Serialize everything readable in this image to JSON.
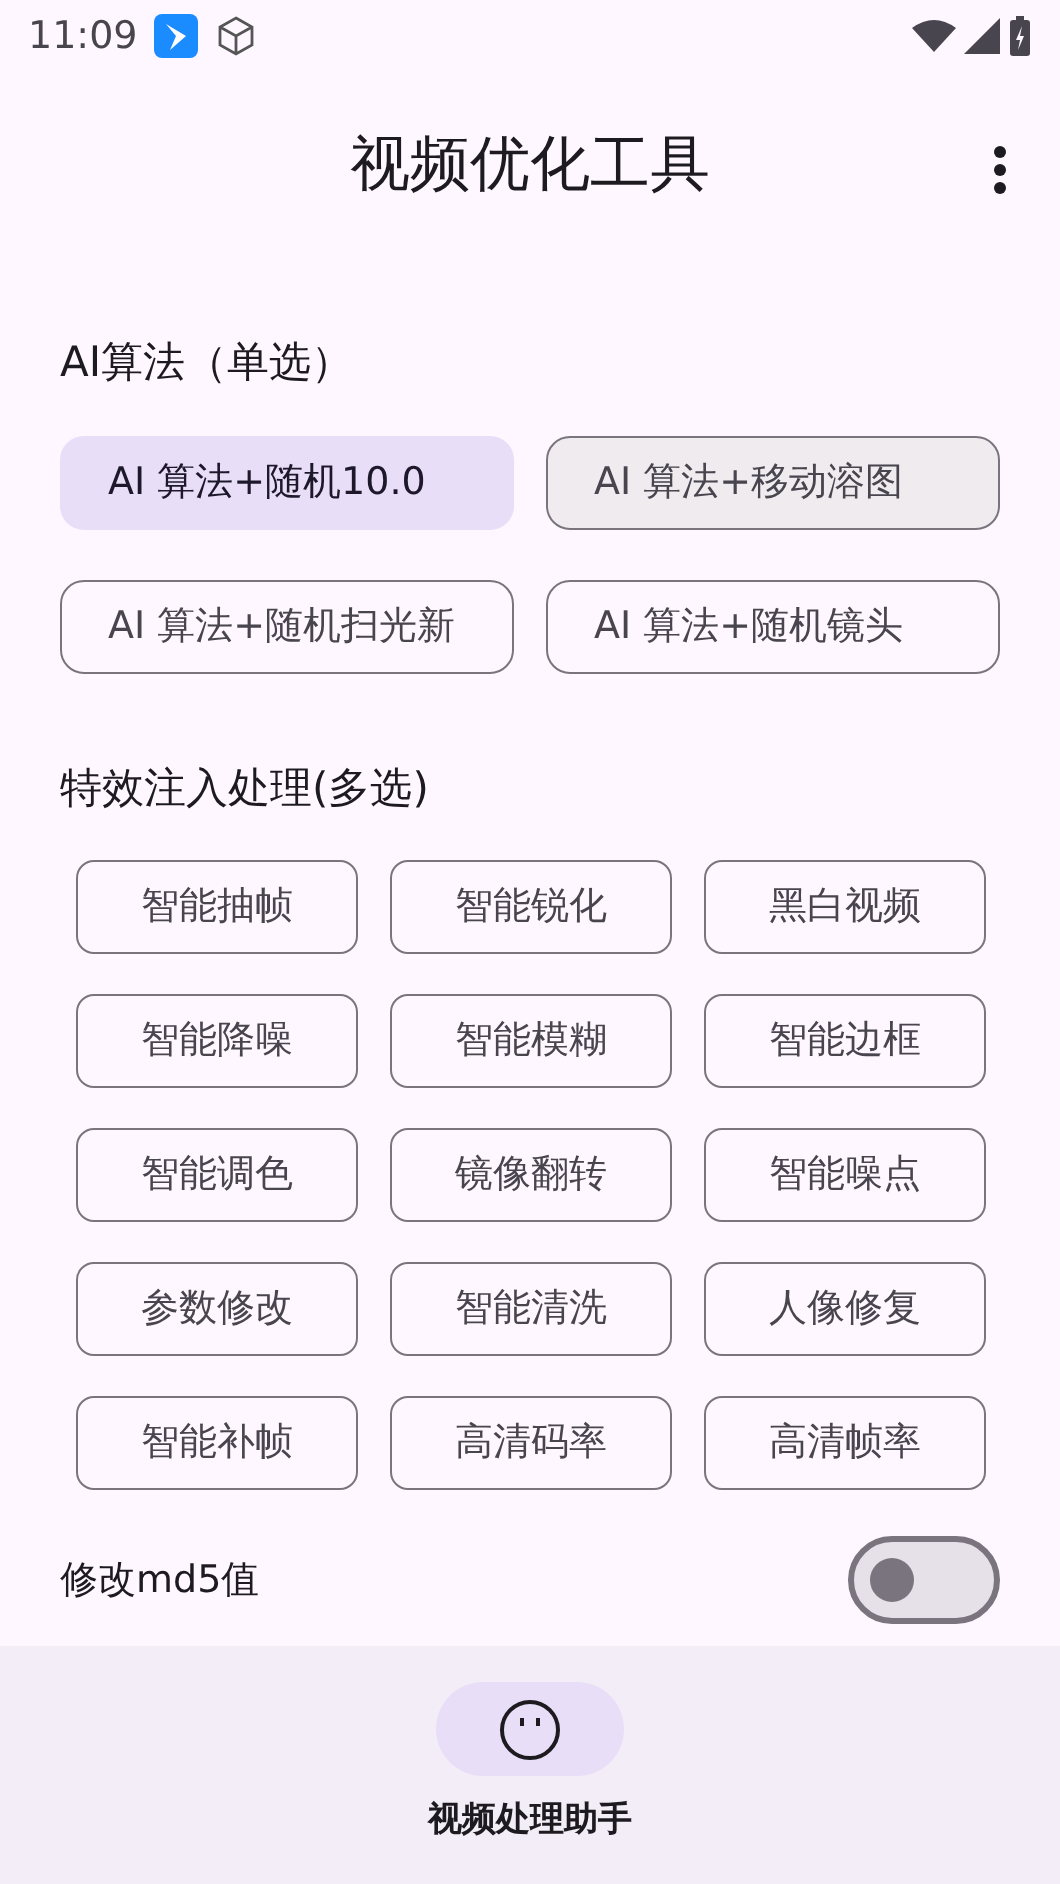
{
  "status_bar": {
    "time": "11:09"
  },
  "app_bar": {
    "title": "视频优化工具"
  },
  "algorithm": {
    "heading": "AI算法（单选）",
    "options": [
      {
        "label": "AI 算法+随机10.0",
        "selected": true,
        "pressed": false
      },
      {
        "label": "AI 算法+移动溶图",
        "selected": false,
        "pressed": true
      },
      {
        "label": "AI 算法+随机扫光新",
        "selected": false,
        "pressed": false
      },
      {
        "label": "AI 算法+随机镜头",
        "selected": false,
        "pressed": false
      }
    ]
  },
  "effects": {
    "heading": "特效注入处理(多选)",
    "options": [
      {
        "label": "智能抽帧",
        "selected": false
      },
      {
        "label": "智能锐化",
        "selected": false
      },
      {
        "label": "黑白视频",
        "selected": false
      },
      {
        "label": "智能降噪",
        "selected": false
      },
      {
        "label": "智能模糊",
        "selected": false
      },
      {
        "label": "智能边框",
        "selected": false
      },
      {
        "label": "智能调色",
        "selected": false
      },
      {
        "label": "镜像翻转",
        "selected": false
      },
      {
        "label": "智能噪点",
        "selected": false
      },
      {
        "label": "参数修改",
        "selected": false
      },
      {
        "label": "智能清洗",
        "selected": false
      },
      {
        "label": "人像修复",
        "selected": false
      },
      {
        "label": "智能补帧",
        "selected": false
      },
      {
        "label": "高清码率",
        "selected": false
      },
      {
        "label": "高清帧率",
        "selected": false
      }
    ]
  },
  "md5": {
    "label": "修改md5值",
    "on": false
  },
  "bottom_nav": [
    {
      "label": "视频处理助手",
      "selected": true
    }
  ]
}
